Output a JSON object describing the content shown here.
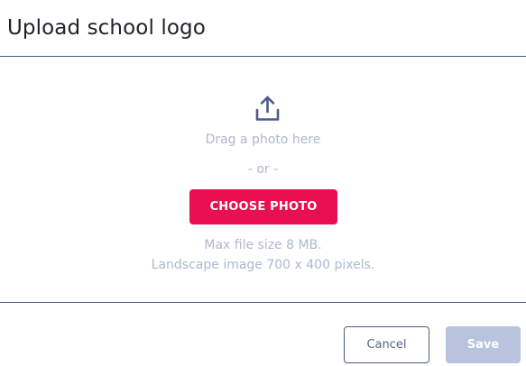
{
  "dialog": {
    "title": "Upload school logo"
  },
  "upload": {
    "icon": "upload-icon",
    "drag_text": "Drag a photo here",
    "or_text": "- or -",
    "choose_label": "CHOOSE PHOTO",
    "hint_size": "Max file size 8 MB.",
    "hint_dimensions": "Landscape image 700 x 400 pixels."
  },
  "footer": {
    "cancel_label": "Cancel",
    "save_label": "Save",
    "save_enabled": false
  },
  "colors": {
    "accent": "#e8104e",
    "divider": "#4d5c86",
    "muted_text": "#aeb8d0",
    "disabled_button": "#b8c3dd",
    "icon": "#4d5c86"
  }
}
